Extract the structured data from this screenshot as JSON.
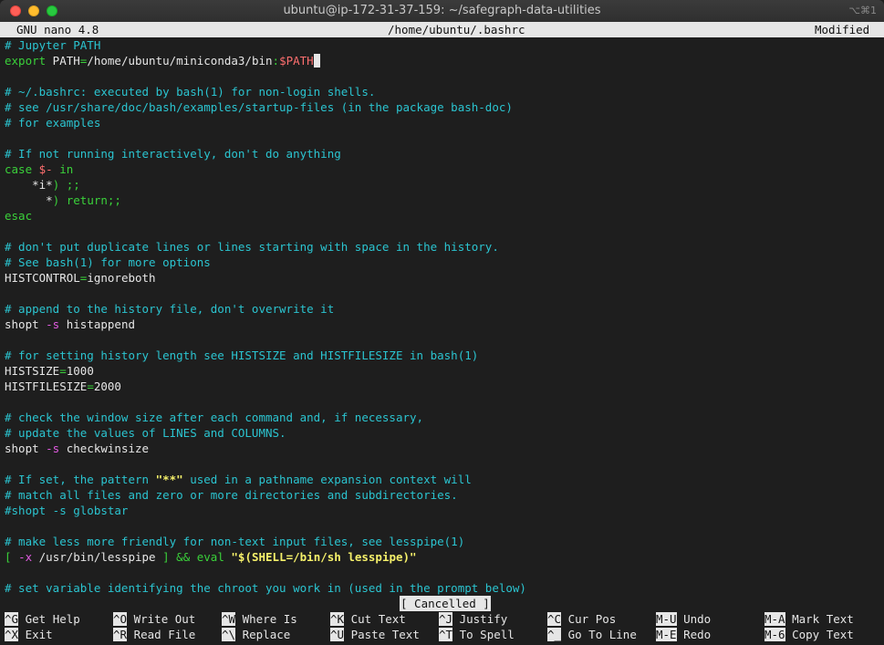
{
  "window": {
    "title": "ubuntu@ip-172-31-37-159: ~/safegraph-data-utilities",
    "shortcut_hint": "⌥⌘1"
  },
  "nano": {
    "version": "GNU nano 4.8",
    "file": "/home/ubuntu/.bashrc",
    "state": "Modified",
    "status_message": "[ Cancelled ]"
  },
  "editor": {
    "lines": [
      [
        {
          "t": "# Jupyter PATH",
          "c": "com"
        }
      ],
      [
        {
          "t": "export",
          "c": "kw"
        },
        {
          "t": " PATH",
          "c": "txt"
        },
        {
          "t": "=",
          "c": "op"
        },
        {
          "t": "/home/ubuntu/miniconda3/bin",
          "c": "txt"
        },
        {
          "t": ":",
          "c": "op"
        },
        {
          "t": "$PATH",
          "c": "var"
        },
        {
          "t": " ",
          "c": "cursor"
        }
      ],
      [],
      [
        {
          "t": "# ~/.bashrc: executed by bash(1) for non-login shells.",
          "c": "com"
        }
      ],
      [
        {
          "t": "# see /usr/share/doc/bash/examples/startup-files (in the package bash-doc)",
          "c": "com"
        }
      ],
      [
        {
          "t": "# for examples",
          "c": "com"
        }
      ],
      [],
      [
        {
          "t": "# If not running interactively, don't do anything",
          "c": "com"
        }
      ],
      [
        {
          "t": "case",
          "c": "kw"
        },
        {
          "t": " ",
          "c": "txt"
        },
        {
          "t": "$-",
          "c": "var"
        },
        {
          "t": " ",
          "c": "txt"
        },
        {
          "t": "in",
          "c": "kw"
        }
      ],
      [
        {
          "t": "    *i*",
          "c": "txt"
        },
        {
          "t": ") ;;",
          "c": "kw"
        }
      ],
      [
        {
          "t": "      *",
          "c": "txt"
        },
        {
          "t": ") return;;",
          "c": "kw"
        }
      ],
      [
        {
          "t": "esac",
          "c": "kw"
        }
      ],
      [],
      [
        {
          "t": "# don't put duplicate lines or lines starting with space in the history.",
          "c": "com"
        }
      ],
      [
        {
          "t": "# See bash(1) for more options",
          "c": "com"
        }
      ],
      [
        {
          "t": "HISTCONTROL",
          "c": "txt"
        },
        {
          "t": "=",
          "c": "op"
        },
        {
          "t": "ignoreboth",
          "c": "txt"
        }
      ],
      [],
      [
        {
          "t": "# append to the history file, don't overwrite it",
          "c": "com"
        }
      ],
      [
        {
          "t": "shopt ",
          "c": "txt"
        },
        {
          "t": "-s",
          "c": "mag"
        },
        {
          "t": " histappend",
          "c": "txt"
        }
      ],
      [],
      [
        {
          "t": "# for setting history length see HISTSIZE and HISTFILESIZE in bash(1)",
          "c": "com"
        }
      ],
      [
        {
          "t": "HISTSIZE",
          "c": "txt"
        },
        {
          "t": "=",
          "c": "op"
        },
        {
          "t": "1000",
          "c": "txt"
        }
      ],
      [
        {
          "t": "HISTFILESIZE",
          "c": "txt"
        },
        {
          "t": "=",
          "c": "op"
        },
        {
          "t": "2000",
          "c": "txt"
        }
      ],
      [],
      [
        {
          "t": "# check the window size after each command and, if necessary,",
          "c": "com"
        }
      ],
      [
        {
          "t": "# update the values of LINES and COLUMNS.",
          "c": "com"
        }
      ],
      [
        {
          "t": "shopt ",
          "c": "txt"
        },
        {
          "t": "-s",
          "c": "mag"
        },
        {
          "t": " checkwinsize",
          "c": "txt"
        }
      ],
      [],
      [
        {
          "t": "# If set, the pattern ",
          "c": "com"
        },
        {
          "t": "\"**\"",
          "c": "str"
        },
        {
          "t": " used in a pathname expansion context will",
          "c": "com"
        }
      ],
      [
        {
          "t": "# match all files and zero or more directories and subdirectories.",
          "c": "com"
        }
      ],
      [
        {
          "t": "#shopt -s globstar",
          "c": "com"
        }
      ],
      [],
      [
        {
          "t": "# make less more friendly for non-text input files, see lesspipe(1)",
          "c": "com"
        }
      ],
      [
        {
          "t": "[ ",
          "c": "kw"
        },
        {
          "t": "-x",
          "c": "mag"
        },
        {
          "t": " /usr/bin/lesspipe ",
          "c": "txt"
        },
        {
          "t": "] && eval ",
          "c": "kw"
        },
        {
          "t": "\"$(SHELL=/bin/sh lesspipe)\"",
          "c": "str"
        }
      ],
      [],
      [
        {
          "t": "# set variable identifying the chroot you work in (used in the prompt below)",
          "c": "com"
        }
      ]
    ]
  },
  "shortcuts": [
    [
      {
        "key": "^G",
        "label": "Get Help"
      },
      {
        "key": "^O",
        "label": "Write Out"
      },
      {
        "key": "^W",
        "label": "Where Is"
      },
      {
        "key": "^K",
        "label": "Cut Text"
      },
      {
        "key": "^J",
        "label": "Justify"
      },
      {
        "key": "^C",
        "label": "Cur Pos"
      },
      {
        "key": "M-U",
        "label": "Undo"
      },
      {
        "key": "M-A",
        "label": "Mark Text"
      }
    ],
    [
      {
        "key": "^X",
        "label": "Exit"
      },
      {
        "key": "^R",
        "label": "Read File"
      },
      {
        "key": "^\\",
        "label": "Replace"
      },
      {
        "key": "^U",
        "label": "Paste Text"
      },
      {
        "key": "^T",
        "label": "To Spell"
      },
      {
        "key": "^_",
        "label": "Go To Line"
      },
      {
        "key": "M-E",
        "label": "Redo"
      },
      {
        "key": "M-6",
        "label": "Copy Text"
      }
    ]
  ]
}
